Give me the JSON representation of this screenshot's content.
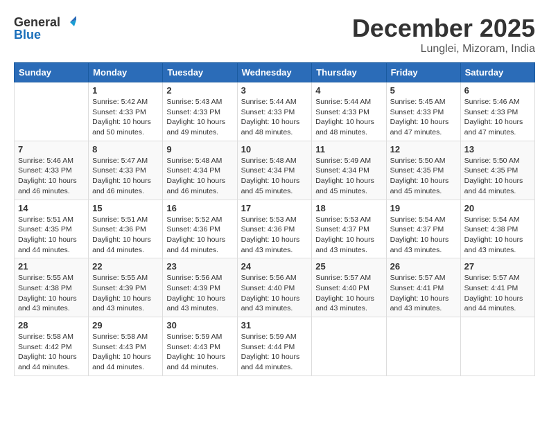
{
  "logo": {
    "text_general": "General",
    "text_blue": "Blue"
  },
  "title": {
    "month": "December 2025",
    "location": "Lunglei, Mizoram, India"
  },
  "weekdays": [
    "Sunday",
    "Monday",
    "Tuesday",
    "Wednesday",
    "Thursday",
    "Friday",
    "Saturday"
  ],
  "weeks": [
    [
      {
        "day": "",
        "info": ""
      },
      {
        "day": "1",
        "info": "Sunrise: 5:42 AM\nSunset: 4:33 PM\nDaylight: 10 hours\nand 50 minutes."
      },
      {
        "day": "2",
        "info": "Sunrise: 5:43 AM\nSunset: 4:33 PM\nDaylight: 10 hours\nand 49 minutes."
      },
      {
        "day": "3",
        "info": "Sunrise: 5:44 AM\nSunset: 4:33 PM\nDaylight: 10 hours\nand 48 minutes."
      },
      {
        "day": "4",
        "info": "Sunrise: 5:44 AM\nSunset: 4:33 PM\nDaylight: 10 hours\nand 48 minutes."
      },
      {
        "day": "5",
        "info": "Sunrise: 5:45 AM\nSunset: 4:33 PM\nDaylight: 10 hours\nand 47 minutes."
      },
      {
        "day": "6",
        "info": "Sunrise: 5:46 AM\nSunset: 4:33 PM\nDaylight: 10 hours\nand 47 minutes."
      }
    ],
    [
      {
        "day": "7",
        "info": "Sunrise: 5:46 AM\nSunset: 4:33 PM\nDaylight: 10 hours\nand 46 minutes."
      },
      {
        "day": "8",
        "info": "Sunrise: 5:47 AM\nSunset: 4:33 PM\nDaylight: 10 hours\nand 46 minutes."
      },
      {
        "day": "9",
        "info": "Sunrise: 5:48 AM\nSunset: 4:34 PM\nDaylight: 10 hours\nand 46 minutes."
      },
      {
        "day": "10",
        "info": "Sunrise: 5:48 AM\nSunset: 4:34 PM\nDaylight: 10 hours\nand 45 minutes."
      },
      {
        "day": "11",
        "info": "Sunrise: 5:49 AM\nSunset: 4:34 PM\nDaylight: 10 hours\nand 45 minutes."
      },
      {
        "day": "12",
        "info": "Sunrise: 5:50 AM\nSunset: 4:35 PM\nDaylight: 10 hours\nand 45 minutes."
      },
      {
        "day": "13",
        "info": "Sunrise: 5:50 AM\nSunset: 4:35 PM\nDaylight: 10 hours\nand 44 minutes."
      }
    ],
    [
      {
        "day": "14",
        "info": "Sunrise: 5:51 AM\nSunset: 4:35 PM\nDaylight: 10 hours\nand 44 minutes."
      },
      {
        "day": "15",
        "info": "Sunrise: 5:51 AM\nSunset: 4:36 PM\nDaylight: 10 hours\nand 44 minutes."
      },
      {
        "day": "16",
        "info": "Sunrise: 5:52 AM\nSunset: 4:36 PM\nDaylight: 10 hours\nand 44 minutes."
      },
      {
        "day": "17",
        "info": "Sunrise: 5:53 AM\nSunset: 4:36 PM\nDaylight: 10 hours\nand 43 minutes."
      },
      {
        "day": "18",
        "info": "Sunrise: 5:53 AM\nSunset: 4:37 PM\nDaylight: 10 hours\nand 43 minutes."
      },
      {
        "day": "19",
        "info": "Sunrise: 5:54 AM\nSunset: 4:37 PM\nDaylight: 10 hours\nand 43 minutes."
      },
      {
        "day": "20",
        "info": "Sunrise: 5:54 AM\nSunset: 4:38 PM\nDaylight: 10 hours\nand 43 minutes."
      }
    ],
    [
      {
        "day": "21",
        "info": "Sunrise: 5:55 AM\nSunset: 4:38 PM\nDaylight: 10 hours\nand 43 minutes."
      },
      {
        "day": "22",
        "info": "Sunrise: 5:55 AM\nSunset: 4:39 PM\nDaylight: 10 hours\nand 43 minutes."
      },
      {
        "day": "23",
        "info": "Sunrise: 5:56 AM\nSunset: 4:39 PM\nDaylight: 10 hours\nand 43 minutes."
      },
      {
        "day": "24",
        "info": "Sunrise: 5:56 AM\nSunset: 4:40 PM\nDaylight: 10 hours\nand 43 minutes."
      },
      {
        "day": "25",
        "info": "Sunrise: 5:57 AM\nSunset: 4:40 PM\nDaylight: 10 hours\nand 43 minutes."
      },
      {
        "day": "26",
        "info": "Sunrise: 5:57 AM\nSunset: 4:41 PM\nDaylight: 10 hours\nand 43 minutes."
      },
      {
        "day": "27",
        "info": "Sunrise: 5:57 AM\nSunset: 4:41 PM\nDaylight: 10 hours\nand 44 minutes."
      }
    ],
    [
      {
        "day": "28",
        "info": "Sunrise: 5:58 AM\nSunset: 4:42 PM\nDaylight: 10 hours\nand 44 minutes."
      },
      {
        "day": "29",
        "info": "Sunrise: 5:58 AM\nSunset: 4:43 PM\nDaylight: 10 hours\nand 44 minutes."
      },
      {
        "day": "30",
        "info": "Sunrise: 5:59 AM\nSunset: 4:43 PM\nDaylight: 10 hours\nand 44 minutes."
      },
      {
        "day": "31",
        "info": "Sunrise: 5:59 AM\nSunset: 4:44 PM\nDaylight: 10 hours\nand 44 minutes."
      },
      {
        "day": "",
        "info": ""
      },
      {
        "day": "",
        "info": ""
      },
      {
        "day": "",
        "info": ""
      }
    ]
  ]
}
